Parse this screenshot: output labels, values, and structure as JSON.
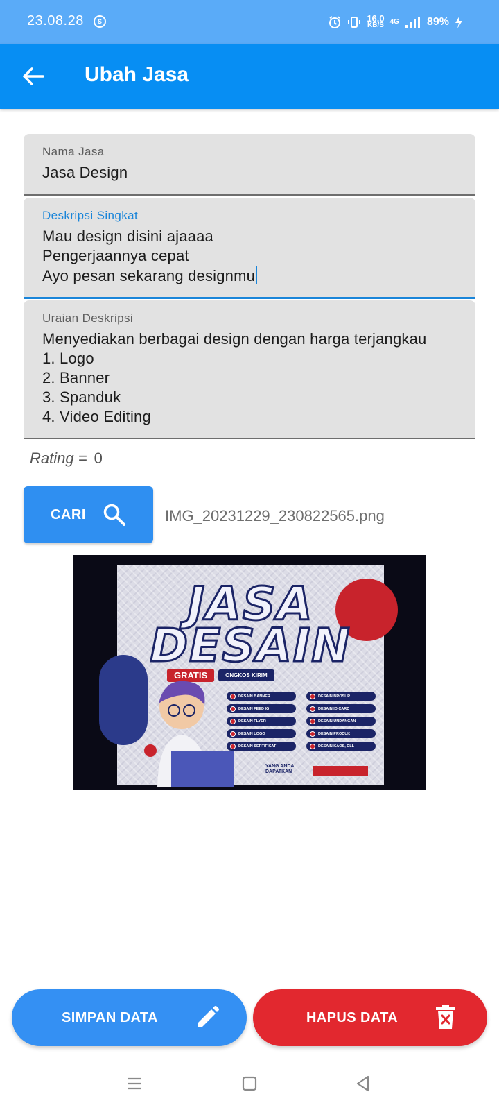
{
  "status_bar": {
    "time": "23.08.28",
    "sync_icon_glyph": "S",
    "net_speed_value": "16.0",
    "net_speed_unit": "KB/S",
    "network_type": "4G",
    "battery": "89%"
  },
  "app_bar": {
    "title": "Ubah Jasa",
    "back_icon": "arrow-left-icon"
  },
  "form": {
    "nama_jasa": {
      "label": "Nama Jasa",
      "value": "Jasa Design"
    },
    "deskripsi_singkat": {
      "label": "Deskripsi Singkat",
      "value": "Mau design disini ajaaaa\nPengerjaannya cepat\nAyo pesan sekarang designmu",
      "focused": true
    },
    "uraian_deskripsi": {
      "label": "Uraian Deskripsi",
      "value": "Menyediakan berbagai design dengan harga terjangkau\n1. Logo\n2. Banner\n3. Spanduk\n4. Video Editing"
    },
    "rating": {
      "label": "Rating =",
      "value": "0"
    }
  },
  "image_picker": {
    "button_label": "CARI",
    "button_icon": "search-icon",
    "file_name": "IMG_20231229_230822565.png"
  },
  "preview_poster": {
    "title_line1": "JASA",
    "title_line2": "DESAIN",
    "badge_gratis": "GRATIS",
    "badge_ongkos": "ONGKOS KIRIM",
    "items_left": [
      "DESAIN BANNER",
      "DESAIN FEED IG",
      "DESAIN FLYER",
      "DESAIN LOGO",
      "DESAIN SERTIFIKAT"
    ],
    "items_right": [
      "DESAIN BROSUR",
      "DESAIN ID CARD",
      "DESAIN UNDANGAN",
      "DESAIN PRODUK",
      "DESAIN KAOS, DLL"
    ],
    "footer_line1": "YANG ANDA",
    "footer_line2": "DAPATKAN"
  },
  "actions": {
    "save_label": "SIMPAN DATA",
    "save_icon": "pencil-icon",
    "delete_label": "HAPUS DATA",
    "delete_icon": "trash-icon"
  },
  "colors": {
    "status_bar": "#5aabf8",
    "app_bar": "#078ef3",
    "primary_button": "#3490f3",
    "danger_button": "#e2282f",
    "focus_accent": "#1a85d9"
  }
}
